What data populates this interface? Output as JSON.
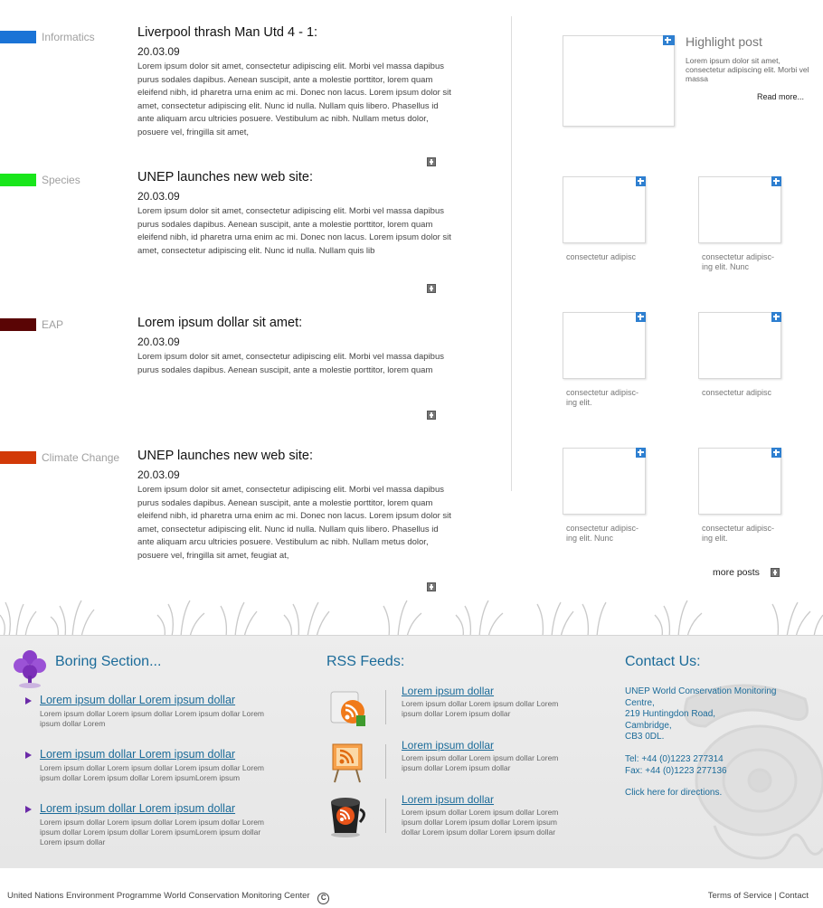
{
  "categories": [
    {
      "label": "Informatics",
      "color": "#1a73d6"
    },
    {
      "label": "Species",
      "color": "#19e61b"
    },
    {
      "label": "EAP",
      "color": "#5a0505"
    },
    {
      "label": "Climate Change",
      "color": "#d23a08"
    }
  ],
  "posts": [
    {
      "title": "Liverpool thrash Man Utd 4 - 1:",
      "date": "20.03.09",
      "body": "Lorem ipsum dolor sit amet, consectetur adipiscing elit. Morbi vel massa dapibus purus sodales dapibus. Aenean suscipit, ante a molestie porttitor, lorem quam eleifend nibh, id pharetra urna enim ac mi. Donec non lacus. Lorem ipsum dolor sit amet, consectetur adipiscing elit. Nunc id nulla. Nullam quis libero. Phasellus id ante aliquam arcu ultricies posuere. Vestibulum ac nibh. Nullam metus dolor, posuere vel, fringilla sit amet,"
    },
    {
      "title": "UNEP launches new web site:",
      "date": "20.03.09",
      "body": "Lorem ipsum dolor sit amet, consectetur adipiscing elit. Morbi vel massa dapibus purus sodales dapibus. Aenean suscipit, ante a molestie porttitor, lorem quam eleifend nibh, id pharetra urna enim ac mi. Donec non lacus. Lorem ipsum dolor sit amet, consectetur adipiscing elit. Nunc id nulla. Nullam quis lib"
    },
    {
      "title": "Lorem ipsum dollar sit amet:",
      "date": "20.03.09",
      "body": "Lorem ipsum dolor sit amet, consectetur adipiscing elit. Morbi vel massa dapibus purus sodales dapibus. Aenean suscipit, ante a molestie porttitor, lorem quam"
    },
    {
      "title": "UNEP launches new web site:",
      "date": "20.03.09",
      "body": "Lorem ipsum dolor sit amet, consectetur adipiscing elit. Morbi vel massa dapibus purus sodales dapibus. Aenean suscipit, ante a molestie porttitor, lorem quam eleifend nibh, id pharetra urna enim ac mi. Donec non lacus. Lorem ipsum dolor sit amet, consectetur adipiscing elit. Nunc id nulla. Nullam quis libero. Phasellus id ante aliquam arcu ultricies posuere. Vestibulum ac nibh. Nullam metus dolor, posuere vel, fringilla sit amet, feugiat at,"
    }
  ],
  "highlight": {
    "title": "Highlight post",
    "text": "Lorem ipsum dolor sit amet, consectetur adipiscing elit. Morbi vel massa",
    "read_more": "Read more..."
  },
  "thumbs": [
    "consectetur adipisc",
    "consectetur adipisc-\ning elit. Nunc",
    "consectetur adipisc-\ning elit.",
    "consectetur adipisc",
    "consectetur adipisc-\ning elit. Nunc",
    "consectetur adipisc-\ning elit."
  ],
  "more_posts": "more posts",
  "footer": {
    "boring": {
      "heading": "Boring Section...",
      "items": [
        {
          "link": "Lorem ipsum dollar Lorem ipsum dollar",
          "desc": "Lorem ipsum dollar Lorem ipsum dollar Lorem ipsum dollar Lorem ipsum dollar Lorem"
        },
        {
          "link": "Lorem ipsum dollar Lorem ipsum dollar",
          "desc": "Lorem ipsum dollar Lorem ipsum dollar Lorem ipsum dollar Lorem ipsum dollar Lorem ipsum dollar Lorem ipsumLorem ipsum"
        },
        {
          "link": "Lorem ipsum dollar Lorem ipsum dollar",
          "desc": "Lorem ipsum dollar Lorem ipsum dollar Lorem ipsum dollar Lorem ipsum dollar Lorem ipsum dollar Lorem ipsumLorem ipsum dollar Lorem ipsum dollar"
        }
      ]
    },
    "rss": {
      "heading": "RSS Feeds:",
      "items": [
        {
          "link": "Lorem ipsum dollar",
          "desc": "Lorem ipsum dollar Lorem ipsum dollar Lorem ipsum dollar Lorem ipsum dollar"
        },
        {
          "link": "Lorem ipsum dollar",
          "desc": "Lorem ipsum dollar Lorem ipsum dollar Lorem ipsum dollar Lorem ipsum dollar"
        },
        {
          "link": "Lorem ipsum dollar",
          "desc": "Lorem ipsum dollar Lorem ipsum dollar Lorem ipsum dollar Lorem ipsum dollar Lorem ipsum dollar Lorem ipsum dollar Lorem ipsum dollar"
        }
      ]
    },
    "contact": {
      "heading": "Contact Us:",
      "address": "UNEP World Conservation Monitoring Centre,\n219 Huntingdon Road,\nCambridge,\nCB3 0DL.",
      "phone": "Tel: +44 (0)1223 277314\nFax: +44 (0)1223 277136",
      "directions": "Click here for directions."
    }
  },
  "bottom": {
    "copyright": "United Nations Environment Programme World Conservation Monitoring Center",
    "copy_symbol": "C",
    "terms": "Terms of Service",
    "separator": "|",
    "contact": "Contact"
  }
}
